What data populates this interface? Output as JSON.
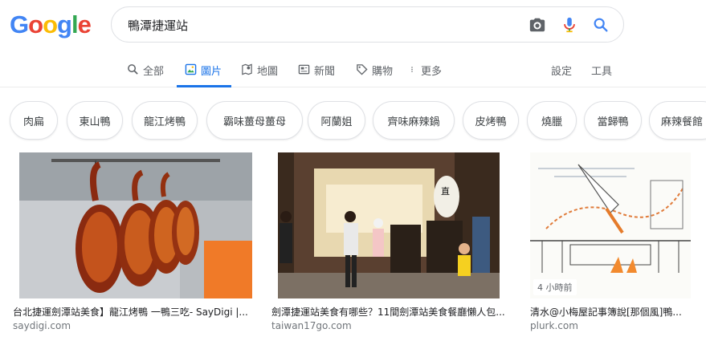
{
  "logo": {
    "letters": [
      "G",
      "o",
      "o",
      "g",
      "l",
      "e"
    ],
    "colors": [
      "#4285f4",
      "#ea4335",
      "#fbbc05",
      "#4285f4",
      "#34a853",
      "#ea4335"
    ]
  },
  "search": {
    "query": "鴨潭捷運站",
    "camera_icon": "camera-icon",
    "mic_icon": "microphone-icon",
    "search_icon": "search-icon"
  },
  "tabs": [
    {
      "label": "全部",
      "icon": "search-icon",
      "active": false
    },
    {
      "label": "圖片",
      "icon": "image-icon",
      "active": true
    },
    {
      "label": "地圖",
      "icon": "map-icon",
      "active": false
    },
    {
      "label": "新聞",
      "icon": "news-icon",
      "active": false
    },
    {
      "label": "購物",
      "icon": "tag-icon",
      "active": false
    },
    {
      "label": "更多",
      "icon": "more-vert-icon",
      "active": false
    }
  ],
  "tools": {
    "settings": "設定",
    "tools": "工具"
  },
  "chips": [
    "肉扁",
    "東山鴨",
    "龍江烤鴨",
    "霸味薑母薑母",
    "阿蘭姐",
    "齊味麻辣鍋",
    "皮烤鴨",
    "燒臘",
    "當歸鴨",
    "麻辣餐館"
  ],
  "results": [
    {
      "caption": "台北捷運劍潭站美食】龍江烤鴨 一鴨三吃- SayDigi |...",
      "source": "saydigi.com",
      "badge": ""
    },
    {
      "caption": "劍潭捷運站美食有哪些？11間劍潭站美食餐廳懶人包...",
      "source": "taiwan17go.com",
      "badge": ""
    },
    {
      "caption": "清水@小梅屋記事簿說[那個風]鴨...",
      "source": "plurk.com",
      "badge": "4 小時前"
    }
  ],
  "colors": {
    "accent": "#1a73e8",
    "text_secondary": "#5f6368",
    "source": "#70757a"
  }
}
